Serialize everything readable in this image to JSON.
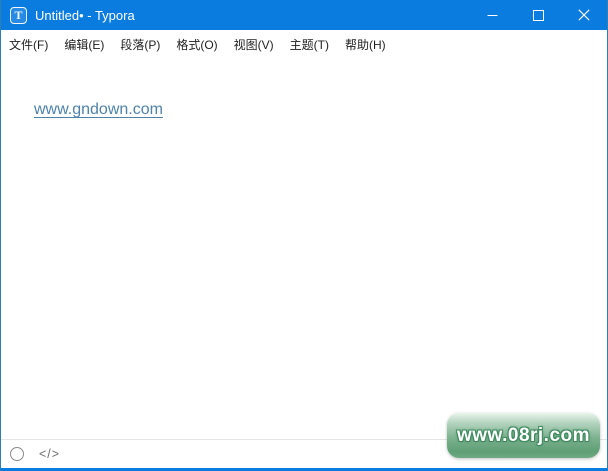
{
  "titlebar": {
    "title": "Untitled• - Typora",
    "app_icon_letter": "T",
    "controls": {
      "minimize": "minimize-icon",
      "maximize": "maximize-icon",
      "close": "close-icon"
    }
  },
  "menu_bar": {
    "items": [
      "文件(F)",
      "编辑(E)",
      "段落(P)",
      "格式(O)",
      "视图(V)",
      "主题(T)",
      "帮助(H)"
    ]
  },
  "editor": {
    "link_text": "www.gndown.com"
  },
  "status_bar": {
    "outline_icon": "circle-outline-icon",
    "source_code_glyph": "</>"
  },
  "watermark": {
    "text": "www.08rj.com"
  },
  "colors": {
    "titlebar_bg": "#0a7ce0",
    "link": "#4e82aa",
    "watermark_green": "#5f9f76",
    "statusbar_border": "#e5e5e5"
  }
}
